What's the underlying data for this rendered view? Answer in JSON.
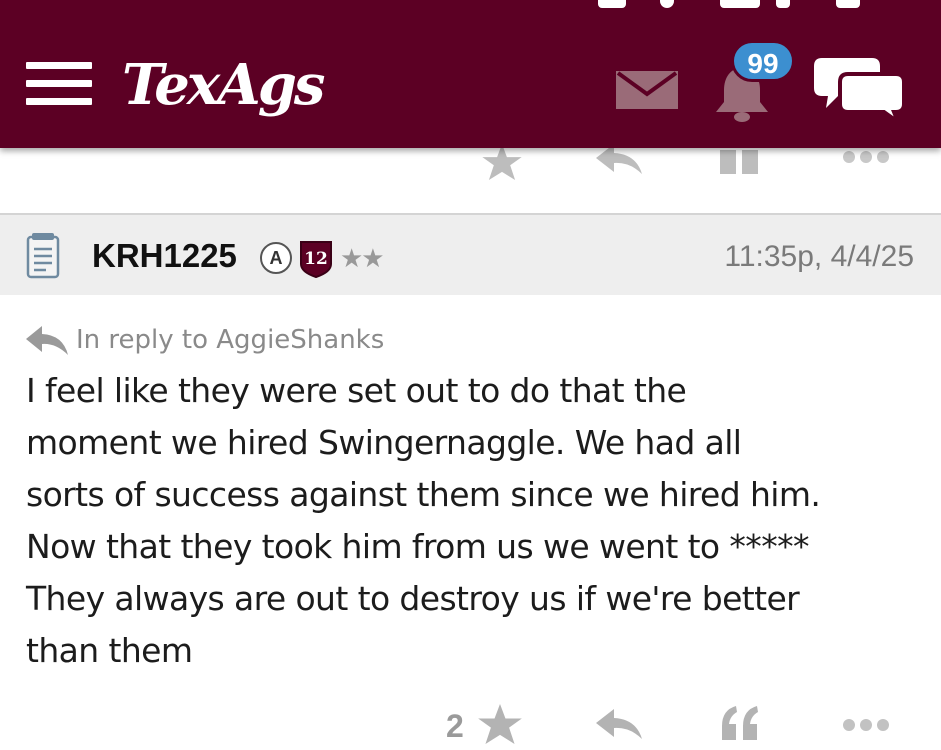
{
  "header": {
    "logo_text": "TexAgs",
    "notification_count": "99",
    "background_color": "#5c0024",
    "badge_color": "#3c8fd0"
  },
  "post": {
    "username": "KRH1225",
    "user_badge_letter": "A",
    "user_badge_number": "12",
    "rank_stars": "★★",
    "timestamp": "11:35p, 4/4/25",
    "reply_to": "In reply to AggieShanks",
    "body_lines": [
      "I feel like they were set out to do that the",
      "moment we hired Swingernaggle. We had all",
      "sorts of success against them since we hired him.",
      "Now that they took him from us we went to *****",
      "They always are out to destroy us if we're better",
      "than them"
    ],
    "like_count": "2"
  },
  "icons": {
    "menu": "hamburger-menu-icon",
    "mail": "mail-icon",
    "bell": "bell-icon",
    "chat": "chat-bubbles-icon",
    "notepad": "notepad-icon",
    "star": "star-icon",
    "reply": "reply-arrow-icon",
    "quote": "quote-icon",
    "more": "more-dots-icon"
  }
}
